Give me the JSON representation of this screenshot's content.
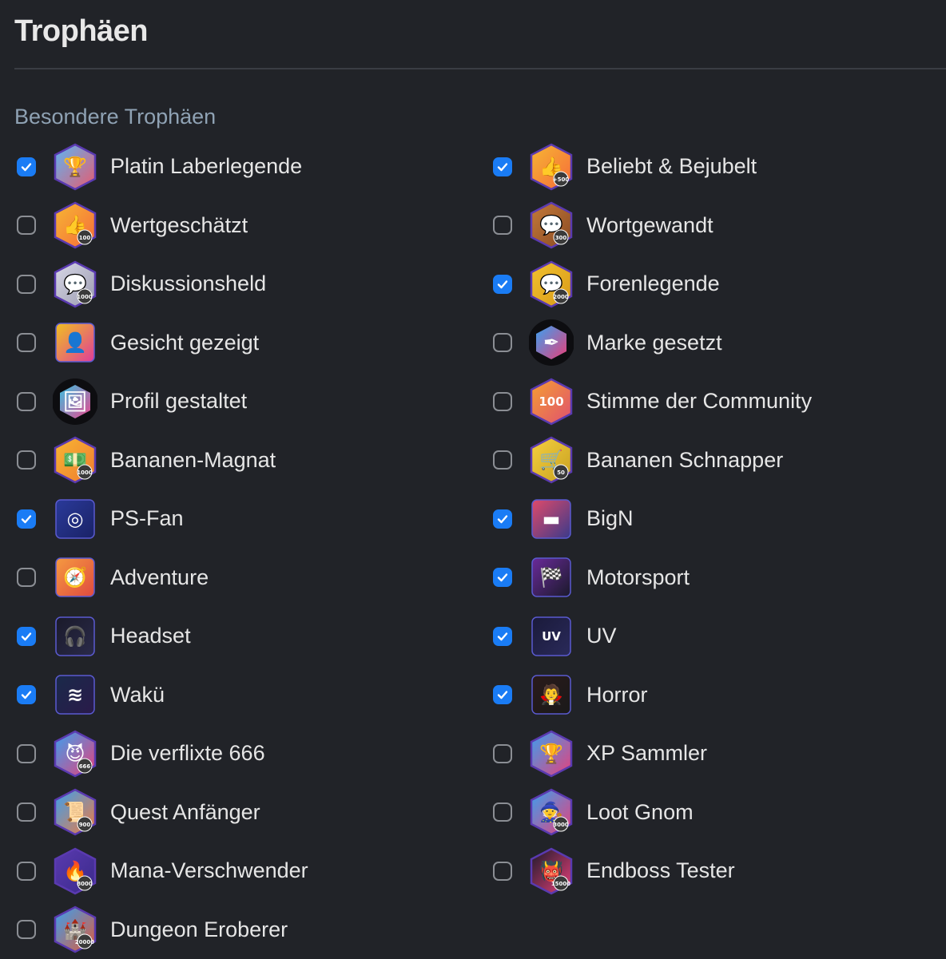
{
  "title": "Trophäen",
  "section": "Besondere Trophäen",
  "trophies": [
    {
      "label": "Platin Laberlegende",
      "checked": true,
      "icon": "platinum-trophy-icon",
      "shape": "hex",
      "c1": "#5bb6f5",
      "c2": "#e85a6e",
      "glyph": "🏆",
      "badge_text": ""
    },
    {
      "label": "Beliebt & Bejubelt",
      "checked": true,
      "icon": "thumbs-up-icon",
      "shape": "hex",
      "c1": "#f7b733",
      "c2": "#f56a3a",
      "glyph": "👍",
      "badge_text": "+500"
    },
    {
      "label": "Wertgeschätzt",
      "checked": false,
      "icon": "thumbs-up-icon",
      "shape": "hex",
      "c1": "#f7b733",
      "c2": "#f56a3a",
      "glyph": "👍",
      "badge_text": "100"
    },
    {
      "label": "Wortgewandt",
      "checked": false,
      "icon": "chat-bubble-icon",
      "shape": "hex",
      "c1": "#c47a3a",
      "c2": "#8a4a22",
      "glyph": "💬",
      "badge_text": "300"
    },
    {
      "label": "Diskussionsheld",
      "checked": false,
      "icon": "chat-bubble-icon",
      "shape": "hex",
      "c1": "#d8d8e6",
      "c2": "#9b9bb0",
      "glyph": "💬",
      "badge_text": "1000"
    },
    {
      "label": "Forenlegende",
      "checked": true,
      "icon": "chat-bubble-icon",
      "shape": "hex",
      "c1": "#f2c230",
      "c2": "#d89a18",
      "glyph": "💬",
      "badge_text": "2000"
    },
    {
      "label": "Gesicht gezeigt",
      "checked": false,
      "icon": "user-avatar-icon",
      "shape": "square",
      "c1": "#f0c020",
      "c2": "#e03c9a",
      "glyph": "👤",
      "badge_text": ""
    },
    {
      "label": "Marke gesetzt",
      "checked": false,
      "icon": "pen-icon",
      "shape": "circle",
      "c1": "#3aa0f0",
      "c2": "#e8407a",
      "glyph": "✒",
      "badge_text": ""
    },
    {
      "label": "Profil gestaltet",
      "checked": false,
      "icon": "image-icon",
      "shape": "circle",
      "c1": "#3ac0e0",
      "c2": "#e84a90",
      "glyph": "🖼",
      "badge_text": ""
    },
    {
      "label": "Stimme der Community",
      "checked": false,
      "icon": "speech-100-icon",
      "shape": "hex",
      "c1": "#f5a030",
      "c2": "#e05070",
      "glyph": "100",
      "badge_text": ""
    },
    {
      "label": "Bananen-Magnat",
      "checked": false,
      "icon": "banana-money-icon",
      "shape": "hex",
      "c1": "#f7b733",
      "c2": "#f07a30",
      "glyph": "💵",
      "badge_text": "1000"
    },
    {
      "label": "Bananen Schnapper",
      "checked": false,
      "icon": "shopping-cart-icon",
      "shape": "hex",
      "c1": "#f5d040",
      "c2": "#c8a020",
      "glyph": "🛒",
      "badge_text": "50"
    },
    {
      "label": "PS-Fan",
      "checked": true,
      "icon": "console-icon",
      "shape": "square",
      "c1": "#2a3a9a",
      "c2": "#1a2266",
      "glyph": "◎",
      "badge_text": ""
    },
    {
      "label": "BigN",
      "checked": true,
      "icon": "nes-console-icon",
      "shape": "square",
      "c1": "#e04a6a",
      "c2": "#3a3a8a",
      "glyph": "▬",
      "badge_text": ""
    },
    {
      "label": "Adventure",
      "checked": false,
      "icon": "compass-icon",
      "shape": "square",
      "c1": "#f59a40",
      "c2": "#e04a40",
      "glyph": "🧭",
      "badge_text": ""
    },
    {
      "label": "Motorsport",
      "checked": true,
      "icon": "racing-flag-icon",
      "shape": "square",
      "c1": "#6a2a9a",
      "c2": "#1a1a2a",
      "glyph": "🏁",
      "badge_text": ""
    },
    {
      "label": "Headset",
      "checked": true,
      "icon": "headset-icon",
      "shape": "square",
      "c1": "#1a1a2a",
      "c2": "#2a2a4a",
      "glyph": "🎧",
      "badge_text": ""
    },
    {
      "label": "UV",
      "checked": true,
      "icon": "uv-icon",
      "shape": "square",
      "c1": "#1a1a3a",
      "c2": "#2a2a5a",
      "glyph": "UV",
      "badge_text": ""
    },
    {
      "label": "Wakü",
      "checked": true,
      "icon": "water-cooling-icon",
      "shape": "square",
      "c1": "#1a2a4a",
      "c2": "#2a1a4a",
      "glyph": "≋",
      "badge_text": ""
    },
    {
      "label": "Horror",
      "checked": true,
      "icon": "horror-icon",
      "shape": "square",
      "c1": "#2a1a1a",
      "c2": "#1a1a1a",
      "glyph": "🧛",
      "badge_text": ""
    },
    {
      "label": "Die verflixte 666",
      "checked": false,
      "icon": "devil-banana-icon",
      "shape": "hex",
      "c1": "#3aa0f0",
      "c2": "#e8407a",
      "glyph": "😈",
      "badge_text": "666"
    },
    {
      "label": "XP Sammler",
      "checked": false,
      "icon": "trophy-cup-icon",
      "shape": "hex",
      "c1": "#3aa0f0",
      "c2": "#e8407a",
      "glyph": "🏆",
      "badge_text": ""
    },
    {
      "label": "Quest Anfänger",
      "checked": false,
      "icon": "scroll-icon",
      "shape": "hex",
      "c1": "#3aa0f0",
      "c2": "#f07a40",
      "glyph": "📜",
      "badge_text": "900"
    },
    {
      "label": "Loot Gnom",
      "checked": false,
      "icon": "gnome-icon",
      "shape": "hex",
      "c1": "#3aa0f0",
      "c2": "#e8407a",
      "glyph": "🧙",
      "badge_text": "3000"
    },
    {
      "label": "Mana-Verschwender",
      "checked": false,
      "icon": "mana-fire-icon",
      "shape": "hex",
      "c1": "#5a3ab0",
      "c2": "#3a2a8a",
      "glyph": "🔥",
      "badge_text": "8000"
    },
    {
      "label": "Endboss Tester",
      "checked": false,
      "icon": "boss-monster-icon",
      "shape": "hex",
      "c1": "#1a1a2a",
      "c2": "#e8407a",
      "glyph": "👹",
      "badge_text": "15000"
    },
    {
      "label": "Dungeon Eroberer",
      "checked": false,
      "icon": "dungeon-gate-icon",
      "shape": "hex",
      "c1": "#3aa0f0",
      "c2": "#e05a3a",
      "glyph": "🏰",
      "badge_text": "20000"
    }
  ]
}
